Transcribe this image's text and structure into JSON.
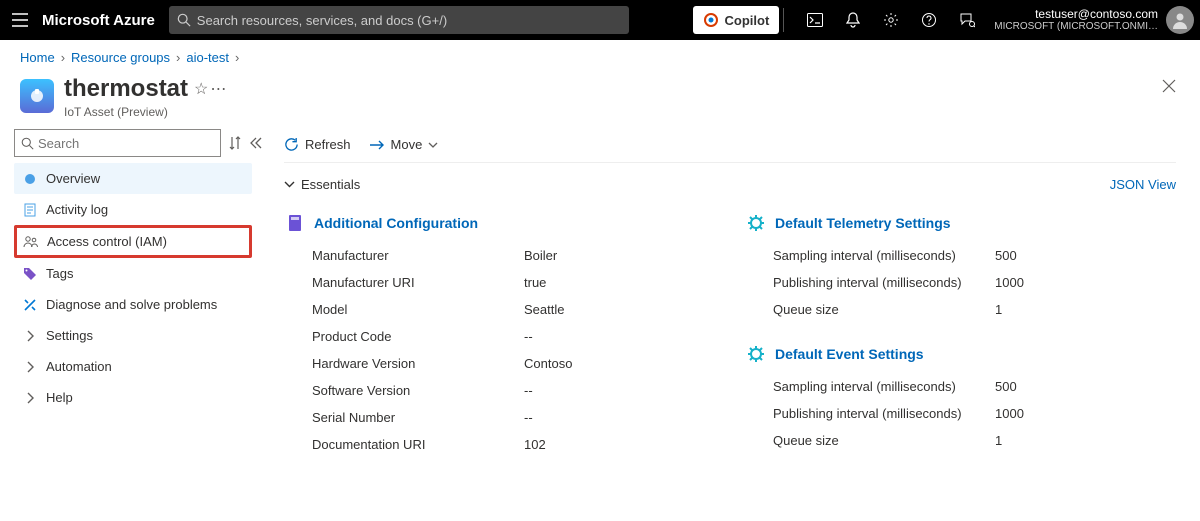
{
  "topbar": {
    "brand": "Microsoft Azure",
    "search_placeholder": "Search resources, services, and docs (G+/)",
    "copilot": "Copilot",
    "user_email": "testuser@contoso.com",
    "org": "MICROSOFT (MICROSOFT.ONMI…"
  },
  "breadcrumb": {
    "items": [
      "Home",
      "Resource groups",
      "aio-test"
    ]
  },
  "header": {
    "title": "thermostat",
    "subtitle": "IoT Asset (Preview)"
  },
  "sidebar": {
    "search_placeholder": "Search",
    "items": [
      {
        "label": "Overview"
      },
      {
        "label": "Activity log"
      },
      {
        "label": "Access control (IAM)"
      },
      {
        "label": "Tags"
      },
      {
        "label": "Diagnose and solve problems"
      },
      {
        "label": "Settings"
      },
      {
        "label": "Automation"
      },
      {
        "label": "Help"
      }
    ]
  },
  "toolbar": {
    "refresh": "Refresh",
    "move": "Move"
  },
  "essentials": {
    "label": "Essentials",
    "json_view": "JSON View"
  },
  "sections": {
    "additional": {
      "title": "Additional Configuration",
      "rows": [
        {
          "k": "Manufacturer",
          "v": "Boiler"
        },
        {
          "k": "Manufacturer URI",
          "v": "true"
        },
        {
          "k": "Model",
          "v": "Seattle"
        },
        {
          "k": "Product Code",
          "v": "--"
        },
        {
          "k": "Hardware Version",
          "v": "Contoso"
        },
        {
          "k": "Software Version",
          "v": "--"
        },
        {
          "k": "Serial Number",
          "v": "--"
        },
        {
          "k": "Documentation URI",
          "v": "102"
        }
      ]
    },
    "telemetry": {
      "title": "Default Telemetry Settings",
      "rows": [
        {
          "k": "Sampling interval (milliseconds)",
          "v": "500"
        },
        {
          "k": "Publishing interval (milliseconds)",
          "v": "1000"
        },
        {
          "k": "Queue size",
          "v": "1"
        }
      ]
    },
    "events": {
      "title": "Default Event Settings",
      "rows": [
        {
          "k": "Sampling interval (milliseconds)",
          "v": "500"
        },
        {
          "k": "Publishing interval (milliseconds)",
          "v": "1000"
        },
        {
          "k": "Queue size",
          "v": "1"
        }
      ]
    }
  }
}
